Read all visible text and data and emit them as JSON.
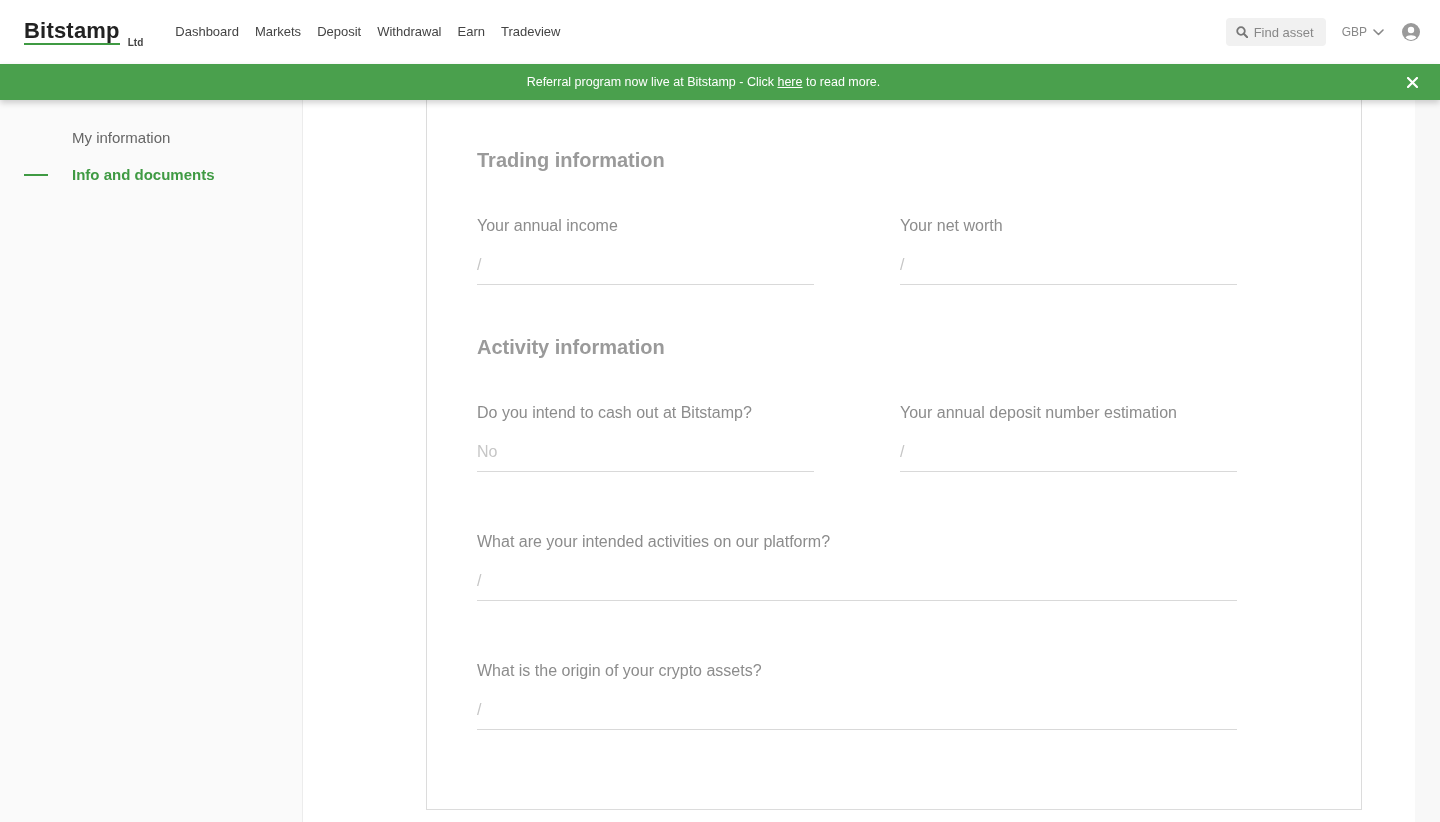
{
  "header": {
    "logo": {
      "wordmark": "Bitstamp",
      "suffix": "Ltd"
    },
    "nav_items": [
      "Dashboard",
      "Markets",
      "Deposit",
      "Withdrawal",
      "Earn",
      "Tradeview"
    ],
    "search": {
      "placeholder": "Find asset"
    },
    "currency": "GBP"
  },
  "banner": {
    "text_before": "Referral program now live at Bitstamp - Click",
    "link": "here",
    "text_after": "to read more."
  },
  "sidebar": {
    "items": [
      {
        "label": "My information",
        "selected": false
      },
      {
        "label": "Info and documents",
        "selected": true
      }
    ]
  },
  "sections": [
    {
      "title": "Trading information",
      "rows": [
        [
          {
            "label": "Your annual income",
            "value": "/"
          },
          {
            "label": "Your net worth",
            "value": "/"
          }
        ]
      ]
    },
    {
      "title": "Activity information",
      "rows": [
        [
          {
            "label": "Do you intend to cash out at Bitstamp?",
            "value": "No"
          },
          {
            "label": "Your annual deposit number estimation",
            "value": "/"
          }
        ],
        [
          {
            "label": "What are your intended activities on our platform?",
            "value": "/"
          }
        ],
        [
          {
            "label": "What is the origin of your crypto assets?",
            "value": "/"
          }
        ]
      ]
    }
  ]
}
